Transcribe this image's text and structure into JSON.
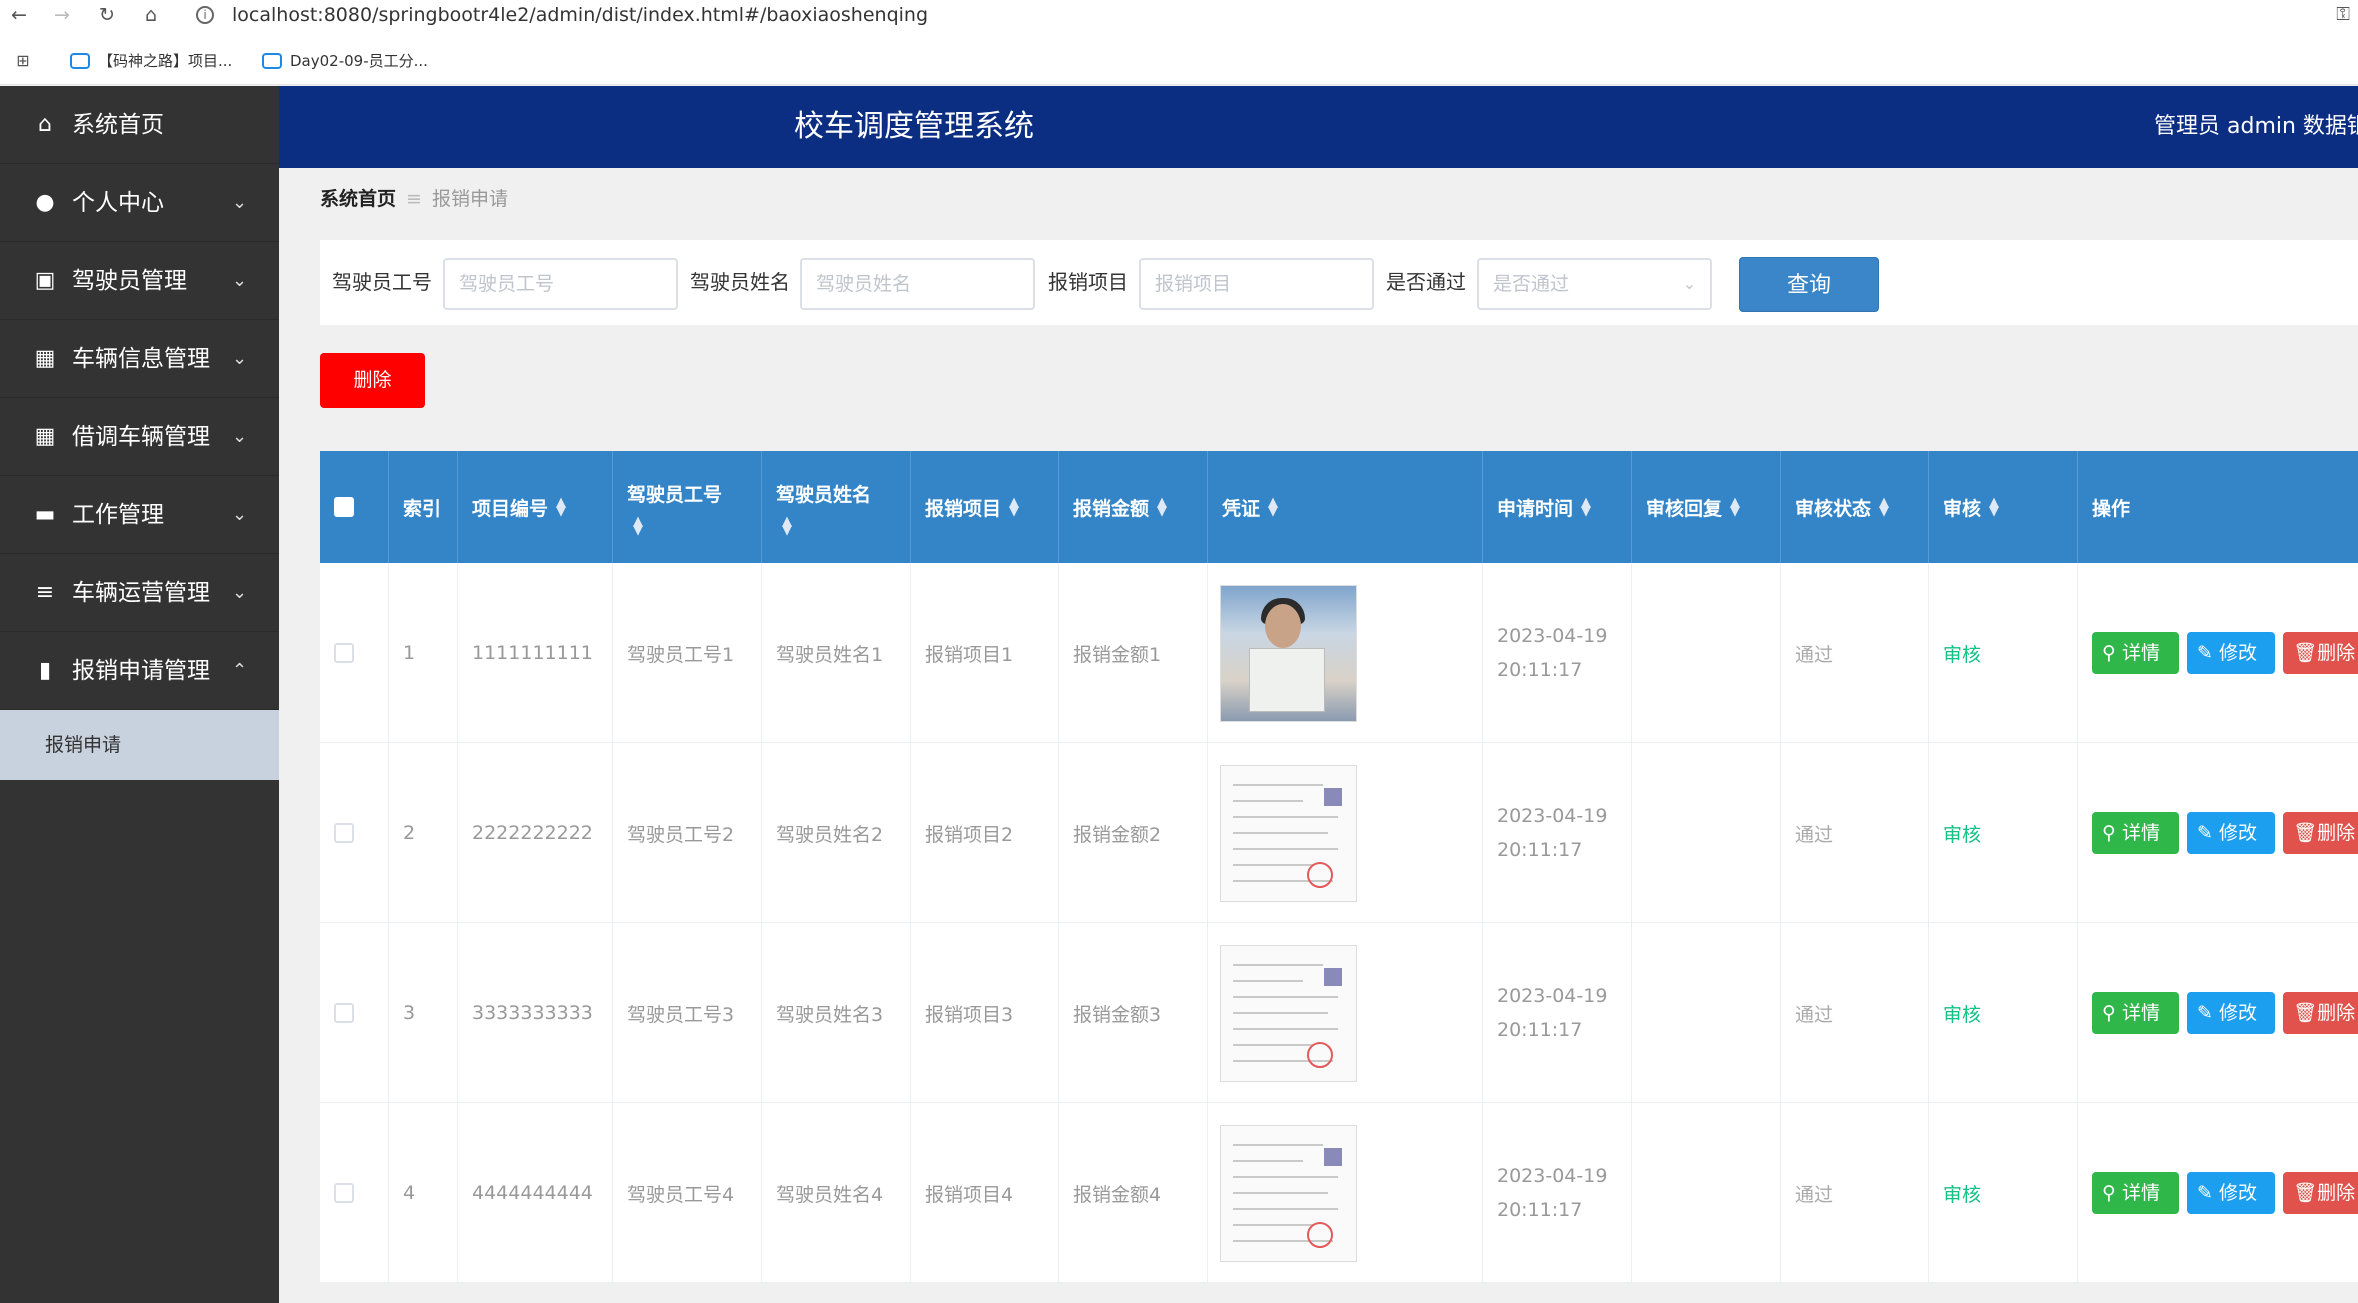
{
  "browser": {
    "url": "localhost:8080/springbootr4le2/admin/dist/index.html#/baoxiaoshenqing",
    "bookmarks": [
      "【码神之路】项目...",
      "Day02-09-员工分..."
    ]
  },
  "sidebar": {
    "items": [
      {
        "label": "系统首页",
        "icon": "home-icon",
        "has_arrow": false
      },
      {
        "label": "个人中心",
        "icon": "user-icon",
        "has_arrow": true
      },
      {
        "label": "驾驶员管理",
        "icon": "clipboard-icon",
        "has_arrow": true
      },
      {
        "label": "车辆信息管理",
        "icon": "grid-icon",
        "has_arrow": true
      },
      {
        "label": "借调车辆管理",
        "icon": "grid-icon",
        "has_arrow": true
      },
      {
        "label": "工作管理",
        "icon": "ticket-icon",
        "has_arrow": true
      },
      {
        "label": "车辆运营管理",
        "icon": "sliders-icon",
        "has_arrow": true
      },
      {
        "label": "报销申请管理",
        "icon": "bar-chart-icon",
        "has_arrow": true,
        "expanded": true
      }
    ],
    "active_sub_item": "报销申请"
  },
  "header": {
    "title": "校车调度管理系统",
    "user_info": "管理员 admin  数据银"
  },
  "breadcrumb": {
    "home": "系统首页",
    "separator": "≡",
    "current": "报销申请"
  },
  "search": {
    "fields": [
      {
        "label": "驾驶员工号",
        "placeholder": "驾驶员工号"
      },
      {
        "label": "驾驶员姓名",
        "placeholder": "驾驶员姓名"
      },
      {
        "label": "报销项目",
        "placeholder": "报销项目"
      }
    ],
    "select_label": "是否通过",
    "select_placeholder": "是否通过",
    "query_button": "查询"
  },
  "actions": {
    "delete_button": "删除"
  },
  "table": {
    "columns": [
      "索引",
      "项目编号",
      "驾驶员工号",
      "驾驶员姓名",
      "报销项目",
      "报销金额",
      "凭证",
      "申请时间",
      "审核回复",
      "审核状态",
      "审核",
      "操作"
    ],
    "rows": [
      {
        "index": "1",
        "code": "1111111111",
        "driver_no": "驾驶员工号1",
        "driver_name": "驾驶员姓名1",
        "item": "报销项目1",
        "amount": "报销金额1",
        "voucher": "photo",
        "date": "2023-04-19",
        "time": "20:11:17",
        "reply": "",
        "status": "通过",
        "audit": "审核"
      },
      {
        "index": "2",
        "code": "2222222222",
        "driver_no": "驾驶员工号2",
        "driver_name": "驾驶员姓名2",
        "item": "报销项目2",
        "amount": "报销金额2",
        "voucher": "doc",
        "date": "2023-04-19",
        "time": "20:11:17",
        "reply": "",
        "status": "通过",
        "audit": "审核"
      },
      {
        "index": "3",
        "code": "3333333333",
        "driver_no": "驾驶员工号3",
        "driver_name": "驾驶员姓名3",
        "item": "报销项目3",
        "amount": "报销金额3",
        "voucher": "doc",
        "date": "2023-04-19",
        "time": "20:11:17",
        "reply": "",
        "status": "通过",
        "audit": "审核"
      },
      {
        "index": "4",
        "code": "4444444444",
        "driver_no": "驾驶员工号4",
        "driver_name": "驾驶员姓名4",
        "item": "报销项目4",
        "amount": "报销金额4",
        "voucher": "doc",
        "date": "2023-04-19",
        "time": "20:11:17",
        "reply": "",
        "status": "通过",
        "audit": "审核"
      }
    ],
    "row_actions": {
      "detail": "详情",
      "edit": "修改",
      "delete": "删除"
    }
  },
  "colors": {
    "header_bg": "#0b2d82",
    "sidebar_bg": "#333333",
    "table_head": "#3385c8",
    "danger": "#ff0000",
    "detail": "#2fb74a",
    "edit": "#1d9ff0",
    "row_delete": "#e0524b",
    "audit": "#13c184"
  }
}
